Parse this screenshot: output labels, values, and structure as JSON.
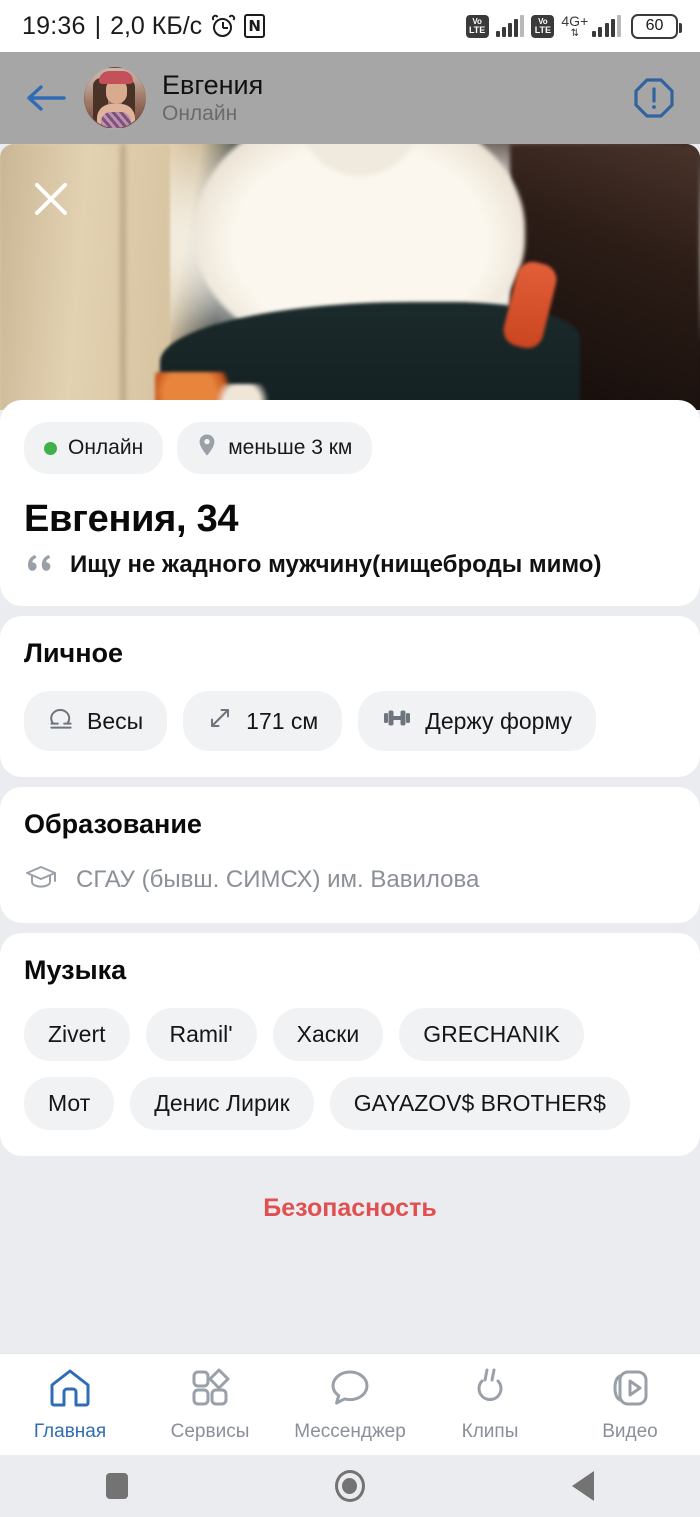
{
  "statusbar": {
    "time": "19:36",
    "separator": "|",
    "data_rate": "2,0 КБ/с",
    "alarm_icon": "alarm-icon",
    "nfc_icon": "nfc-icon",
    "nfc_glyph": "N",
    "volte_top": "Vo",
    "volte_bottom": "LTE",
    "network": "4G+",
    "updown_glyph": "⇅",
    "battery": "60"
  },
  "header": {
    "back_icon": "back-arrow-icon",
    "name": "Евгения",
    "status": "Онлайн",
    "warning_icon": "warning-octagon-icon",
    "accent_blue": "#2f6cb5",
    "background": "#a6a6a6"
  },
  "photo": {
    "close_icon": "close-icon"
  },
  "profile": {
    "online_badge": "Онлайн",
    "online_dot_color": "#42b04a",
    "distance_badge": "меньше 3 км",
    "distance_icon": "location-pin-icon",
    "name_age": "Евгения, 34",
    "quote_icon": "quote-icon",
    "quote": "Ищу не жадного мужчину(нищеброды мимо)"
  },
  "personal": {
    "title": "Личное",
    "items": [
      {
        "icon": "libra-zodiac-icon",
        "label": "Весы"
      },
      {
        "icon": "height-arrows-icon",
        "label": "171 см"
      },
      {
        "icon": "dumbbell-icon",
        "label": "Держу форму"
      }
    ]
  },
  "education": {
    "title": "Образование",
    "icon": "graduation-cap-icon",
    "value": "СГАУ (бывш. СИМСХ) им. Вавилова"
  },
  "music": {
    "title": "Музыка",
    "tags": [
      "Zivert",
      "Ramil'",
      "Хаски",
      "GRECHANIK",
      "Мот",
      "Денис Лирик",
      "GAYAZOV$ BROTHER$"
    ]
  },
  "safety": {
    "label": "Безопасность",
    "color": "#e15050"
  },
  "bottom_nav": {
    "items": [
      {
        "icon": "home-icon",
        "label": "Главная",
        "active": true
      },
      {
        "icon": "grid-icon",
        "label": "Сервисы",
        "active": false
      },
      {
        "icon": "chat-icon",
        "label": "Мессенджер",
        "active": false
      },
      {
        "icon": "clips-icon",
        "label": "Клипы",
        "active": false
      },
      {
        "icon": "video-icon",
        "label": "Видео",
        "active": false
      }
    ]
  },
  "android_nav": {
    "recents_icon": "recents-square-icon",
    "home_icon": "home-circle-icon",
    "back_icon": "back-triangle-icon"
  }
}
